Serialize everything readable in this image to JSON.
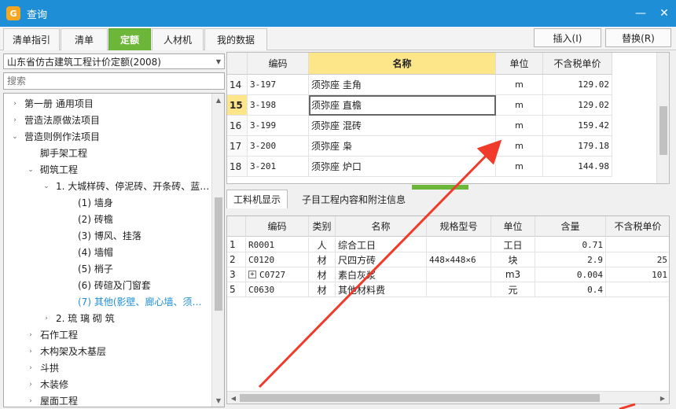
{
  "window": {
    "title": "查询",
    "app_icon_glyph": "G",
    "controls": {
      "minimize": "—",
      "close": "✕"
    }
  },
  "tabs": [
    "清单指引",
    "清单",
    "定额",
    "人材机",
    "我的数据"
  ],
  "active_tab": "定额",
  "actions": {
    "insert": "插入(I)",
    "replace": "替换(R)"
  },
  "left": {
    "quota_library": "山东省仿古建筑工程计价定额(2008)",
    "search_placeholder": "搜索",
    "tree": [
      {
        "label": "第一册  通用项目",
        "arrow": "›",
        "indent": 0
      },
      {
        "label": "营造法原做法项目",
        "arrow": "›",
        "indent": 0
      },
      {
        "label": "营造则例作法项目",
        "arrow": "⌄",
        "indent": 0
      },
      {
        "label": "脚手架工程",
        "arrow": "",
        "indent": 1
      },
      {
        "label": "砌筑工程",
        "arrow": "⌄",
        "indent": 1
      },
      {
        "label": "1. 大城样砖、停泥砖、开条砖、蓝…",
        "arrow": "⌄",
        "indent": 2
      },
      {
        "label": "(1) 墙身",
        "arrow": "",
        "indent": 3
      },
      {
        "label": "(2) 砖檐",
        "arrow": "",
        "indent": 3
      },
      {
        "label": "(3) 博风、挂落",
        "arrow": "",
        "indent": 3
      },
      {
        "label": "(4) 墙帽",
        "arrow": "",
        "indent": 3
      },
      {
        "label": "(5) 梢子",
        "arrow": "",
        "indent": 3
      },
      {
        "label": "(6) 砖碹及门窗套",
        "arrow": "",
        "indent": 3
      },
      {
        "label": "(7) 其他(影壁、廊心墙、须…",
        "arrow": "",
        "indent": 3
      },
      {
        "label": "2. 琉 璃 砌 筑",
        "arrow": "›",
        "indent": 2
      },
      {
        "label": "石作工程",
        "arrow": "›",
        "indent": 1
      },
      {
        "label": "木构架及木基层",
        "arrow": "›",
        "indent": 1
      },
      {
        "label": "斗拱",
        "arrow": "›",
        "indent": 1
      },
      {
        "label": "木装修",
        "arrow": "›",
        "indent": 1
      },
      {
        "label": "屋面工程",
        "arrow": "›",
        "indent": 1
      }
    ],
    "selected_tree_item": "(7) 其他(影壁、廊心墙、须…"
  },
  "top_grid": {
    "headers": [
      "编码",
      "名称",
      "单位",
      "不含税单价"
    ],
    "rows": [
      {
        "no": "14",
        "code": "3-197",
        "name": "须弥座 圭角",
        "unit": "m",
        "price": "129.02"
      },
      {
        "no": "15",
        "code": "3-198",
        "name": "须弥座 直檐",
        "unit": "m",
        "price": "129.02"
      },
      {
        "no": "16",
        "code": "3-199",
        "name": "须弥座 混砖",
        "unit": "m",
        "price": "159.42"
      },
      {
        "no": "17",
        "code": "3-200",
        "name": "须弥座 枭",
        "unit": "m",
        "price": "179.18"
      },
      {
        "no": "18",
        "code": "3-201",
        "name": "须弥座 炉口",
        "unit": "m",
        "price": "144.98"
      }
    ],
    "selected_row": "15"
  },
  "bottom_tabs": [
    "工料机显示",
    "子目工程内容和附注信息"
  ],
  "bottom_grid": {
    "headers": [
      "编码",
      "类别",
      "名称",
      "规格型号",
      "单位",
      "含量",
      "不含税单价"
    ],
    "rows": [
      {
        "no": "1",
        "code": "R0001",
        "category": "人",
        "name": "综合工日",
        "spec": "",
        "unit": "工日",
        "qty": "0.71",
        "price": "",
        "expandable": false
      },
      {
        "no": "2",
        "code": "C0120",
        "category": "材",
        "name": "尺四方砖",
        "spec": "448×448×6",
        "unit": "块",
        "qty": "2.9",
        "price": "25",
        "expandable": false
      },
      {
        "no": "3",
        "code": "C0727",
        "category": "材",
        "name": "素白灰浆",
        "spec": "",
        "unit": "m3",
        "qty": "0.004",
        "price": "101",
        "expandable": true
      },
      {
        "no": "5",
        "code": "C0630",
        "category": "材",
        "name": "其他材料费",
        "spec": "",
        "unit": "元",
        "qty": "0.4",
        "price": "",
        "expandable": false
      }
    ]
  },
  "colors": {
    "titlebar": "#1e8fd6",
    "active_tab": "#6cb73a",
    "header_highlight": "#fde58a",
    "annotation_arrow": "#f03a2a"
  }
}
